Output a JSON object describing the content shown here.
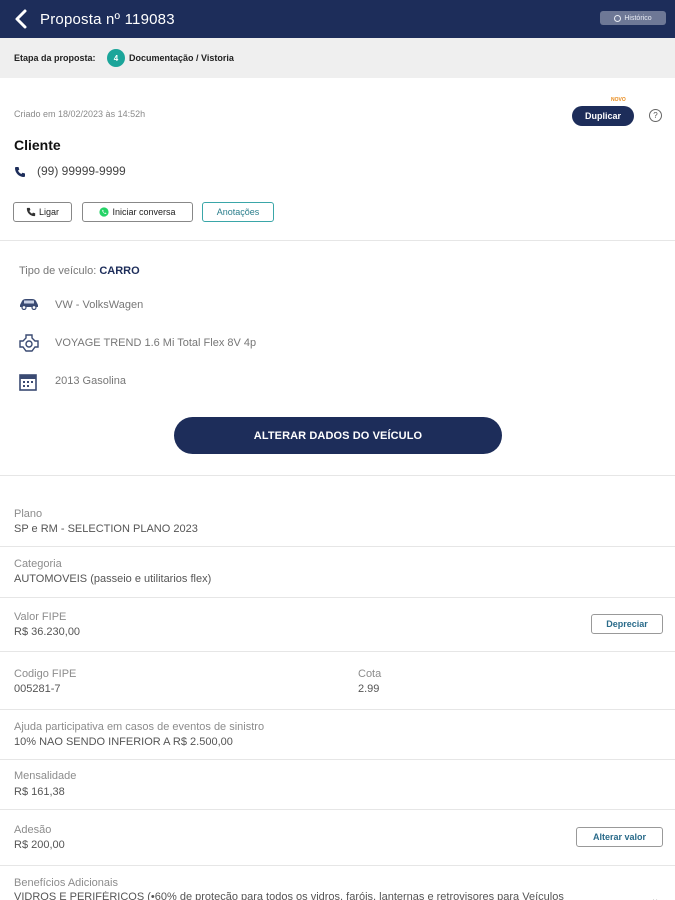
{
  "header": {
    "title": "Proposta nº 119083",
    "historico_label": "Histórico"
  },
  "stage": {
    "label": "Etapa da proposta:",
    "number": "4",
    "value": "Documentação / Vistoria"
  },
  "client": {
    "created": "Criado em 18/02/2023 às 14:52h",
    "novo_badge": "NOVO",
    "duplicate_label": "Duplicar",
    "help_label": "?",
    "name": "Cliente",
    "phone": "(99) 99999-9999",
    "actions": {
      "call": "Ligar",
      "chat": "Iniciar conversa",
      "notes": "Anotações"
    }
  },
  "vehicle": {
    "type_label": "Tipo de veículo:",
    "type_value": "CARRO",
    "brand": "VW - VolksWagen",
    "model": "VOYAGE TREND 1.6 Mi Total Flex 8V 4p",
    "year": "2013 Gasolina",
    "alter_label": "ALTERAR DADOS DO VEÍCULO"
  },
  "fields": {
    "plano_label": "Plano",
    "plano_value": "SP e RM - SELECTION PLANO 2023",
    "categoria_label": "Categoria",
    "categoria_value": "AUTOMOVEIS (passeio e utilitarios flex)",
    "fipe_label": "Valor FIPE",
    "fipe_value": "R$ 36.230,00",
    "depreciar_label": "Depreciar",
    "codigo_label": "Codigo FIPE",
    "codigo_value": "005281-7",
    "cota_label": "Cota",
    "cota_value": "2.99",
    "ajuda_label": "Ajuda participativa em casos de eventos de sinistro",
    "ajuda_value": "10% NAO SENDO INFERIOR A R$ 2.500,00",
    "mensalidade_label": "Mensalidade",
    "mensalidade_value": "R$ 161,38",
    "adesao_label": "Adesão",
    "adesao_value": "R$ 200,00",
    "alterar_valor_label": "Alterar valor",
    "beneficios_label": "Benefícios Adicionais",
    "beneficios_value": "VIDROS E PERIFÉRICOS (•60% de proteção para todos os vidros, faróis, lanternas e retrovisores para Veículos"
  },
  "colors": {
    "primary": "#1d2d5a",
    "teal": "#1ba59a",
    "stage_bg": "#efefef"
  }
}
